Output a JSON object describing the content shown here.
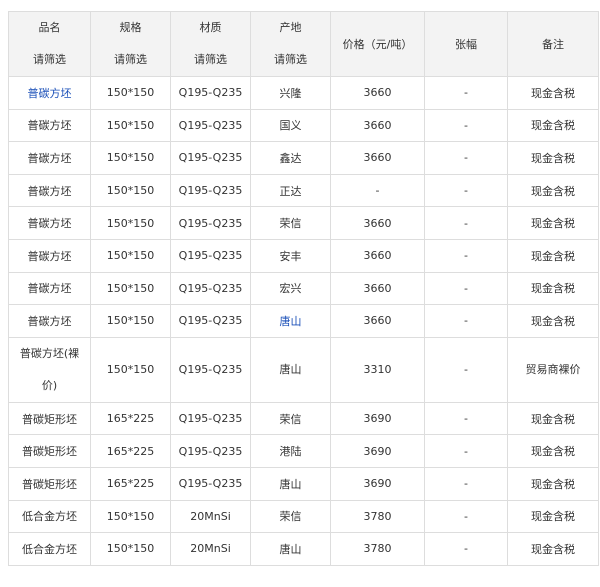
{
  "columns": [
    {
      "label": "品名",
      "filter": "请筛选"
    },
    {
      "label": "规格",
      "filter": "请筛选"
    },
    {
      "label": "材质",
      "filter": "请筛选"
    },
    {
      "label": "产地",
      "filter": "请筛选"
    },
    {
      "label": "价格（元/吨）"
    },
    {
      "label": "张幅"
    },
    {
      "label": "备注"
    }
  ],
  "rows": [
    {
      "name": "普碳方坯",
      "spec": "150*150",
      "material": "Q195-Q235",
      "origin": "兴隆",
      "price": "3660",
      "change": "-",
      "note": "现金含税"
    },
    {
      "name": "普碳方坯",
      "spec": "150*150",
      "material": "Q195-Q235",
      "origin": "国义",
      "price": "3660",
      "change": "-",
      "note": "现金含税"
    },
    {
      "name": "普碳方坯",
      "spec": "150*150",
      "material": "Q195-Q235",
      "origin": "鑫达",
      "price": "3660",
      "change": "-",
      "note": "现金含税"
    },
    {
      "name": "普碳方坯",
      "spec": "150*150",
      "material": "Q195-Q235",
      "origin": "正达",
      "price": "-",
      "change": "-",
      "note": "现金含税"
    },
    {
      "name": "普碳方坯",
      "spec": "150*150",
      "material": "Q195-Q235",
      "origin": "荣信",
      "price": "3660",
      "change": "-",
      "note": "现金含税"
    },
    {
      "name": "普碳方坯",
      "spec": "150*150",
      "material": "Q195-Q235",
      "origin": "安丰",
      "price": "3660",
      "change": "-",
      "note": "现金含税"
    },
    {
      "name": "普碳方坯",
      "spec": "150*150",
      "material": "Q195-Q235",
      "origin": "宏兴",
      "price": "3660",
      "change": "-",
      "note": "现金含税"
    },
    {
      "name": "普碳方坯",
      "spec": "150*150",
      "material": "Q195-Q235",
      "origin": "唐山",
      "price": "3660",
      "change": "-",
      "note": "现金含税"
    },
    {
      "name": "普碳方坯(裸价)",
      "spec": "150*150",
      "material": "Q195-Q235",
      "origin": "唐山",
      "price": "3310",
      "change": "-",
      "note": "贸易商裸价"
    },
    {
      "name": "普碳矩形坯",
      "spec": "165*225",
      "material": "Q195-Q235",
      "origin": "荣信",
      "price": "3690",
      "change": "-",
      "note": "现金含税"
    },
    {
      "name": "普碳矩形坯",
      "spec": "165*225",
      "material": "Q195-Q235",
      "origin": "港陆",
      "price": "3690",
      "change": "-",
      "note": "现金含税"
    },
    {
      "name": "普碳矩形坯",
      "spec": "165*225",
      "material": "Q195-Q235",
      "origin": "唐山",
      "price": "3690",
      "change": "-",
      "note": "现金含税"
    },
    {
      "name": "低合金方坯",
      "spec": "150*150",
      "material": "20MnSi",
      "origin": "荣信",
      "price": "3780",
      "change": "-",
      "note": "现金含税"
    },
    {
      "name": "低合金方坯",
      "spec": "150*150",
      "material": "20MnSi",
      "origin": "唐山",
      "price": "3780",
      "change": "-",
      "note": "现金含税"
    }
  ],
  "link_color": "#1a4fb8",
  "header_bg": "#f3f3f3",
  "border_color": "#dddddd"
}
